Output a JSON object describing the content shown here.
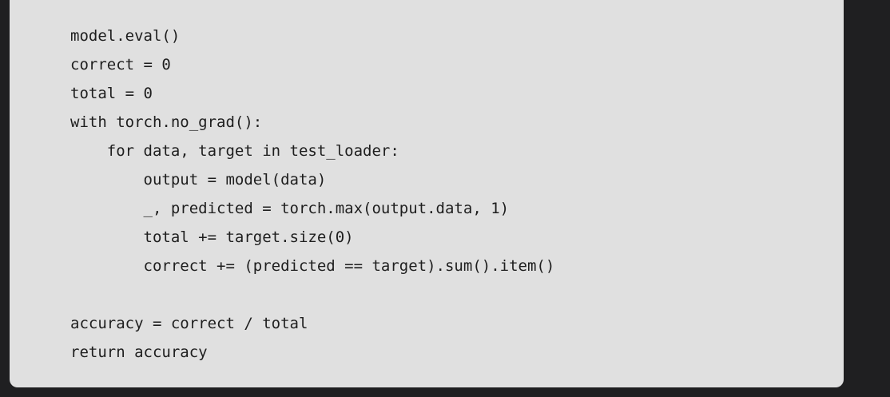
{
  "code": {
    "language": "python",
    "lines": [
      "model.eval()",
      "correct = 0",
      "total = 0",
      "with torch.no_grad():",
      "    for data, target in test_loader:",
      "        output = model(data)",
      "        _, predicted = torch.max(output.data, 1)",
      "        total += target.size(0)",
      "        correct += (predicted == target).sum().item()",
      "",
      "accuracy = correct / total",
      "return accuracy"
    ]
  },
  "colors": {
    "page_background": "#1f1f21",
    "panel_background": "#e0e0e0",
    "code_text": "#1e1e1e"
  }
}
